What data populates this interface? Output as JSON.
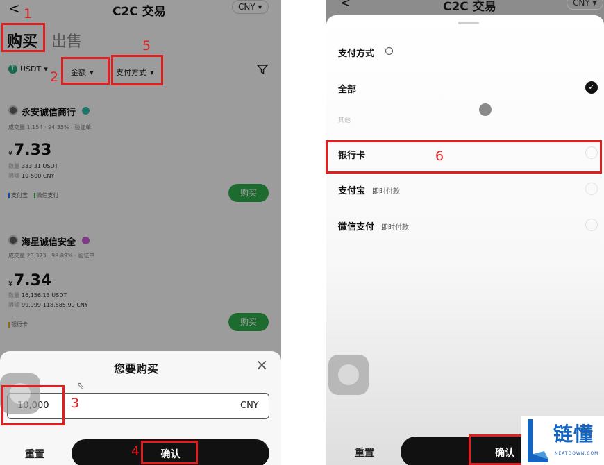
{
  "left": {
    "header": {
      "back": "<",
      "title": "C2C 交易",
      "currency": "CNY"
    },
    "tabs": {
      "buy": "购买",
      "sell": "出售"
    },
    "filters": {
      "coin": "USDT",
      "amount": "金额",
      "payment": "支付方式"
    },
    "listings": [
      {
        "merchant": "永安诚信商行",
        "stats": "成交量 1,154 · 94.35% · 验证单",
        "price": "7.33",
        "quantity_label": "数量",
        "quantity": "333.31 USDT",
        "limit_label": "限额",
        "limit": "10-500 CNY",
        "payments": [
          "支付宝",
          "微信支付"
        ],
        "buy": "购买"
      },
      {
        "merchant": "海星诚信安全",
        "stats": "成交量 23,373 · 99.89% · 验证单",
        "price": "7.34",
        "quantity_label": "数量",
        "quantity": "16,156.13 USDT",
        "limit_label": "限额",
        "limit": "99,999-118,585.99 CNY",
        "payments": [
          "银行卡"
        ],
        "buy": "购买"
      }
    ],
    "dialog": {
      "title": "您要购买",
      "close": "×",
      "amount": "10,000",
      "currency": "CNY",
      "reset": "重置",
      "confirm": "确认"
    }
  },
  "right": {
    "header": {
      "back": "<",
      "title": "C2C 交易",
      "currency": "CNY"
    },
    "sheet": {
      "title": "支付方式",
      "info": "i",
      "options": [
        {
          "label": "全部",
          "sub": "",
          "selected": true
        },
        {
          "label": "其他",
          "sub": "",
          "selected": false
        },
        {
          "label": "银行卡",
          "sub": "",
          "selected": false
        },
        {
          "label": "支付宝",
          "sub": "即时付款",
          "selected": false
        },
        {
          "label": "微信支付",
          "sub": "即时付款",
          "selected": false
        }
      ],
      "reset": "重置",
      "confirm": "确认"
    }
  },
  "annotations": [
    "1",
    "2",
    "3",
    "4",
    "5",
    "6"
  ],
  "watermark": {
    "brand": "链懂",
    "site": "NEATDOWN.COM"
  },
  "colors": {
    "annotation": "#e02020",
    "buy_green": "#2ea84a",
    "brand_blue": "#1565c0"
  }
}
